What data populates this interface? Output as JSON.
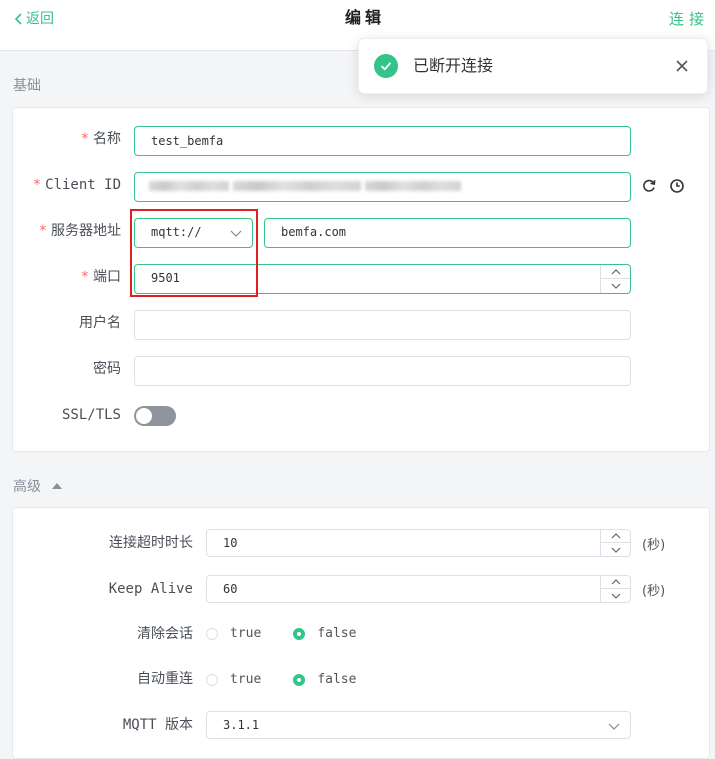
{
  "header": {
    "back_label": "返回",
    "title": "编辑",
    "connect_label": "连接"
  },
  "toast": {
    "message": "已断开连接",
    "status_icon": "check-circle-icon"
  },
  "basic": {
    "section_title": "基础",
    "fields": {
      "name": {
        "label": "名称",
        "required": "*",
        "value": "test_bemfa"
      },
      "client_id": {
        "label": "Client ID",
        "required": "*",
        "value": ""
      },
      "server": {
        "label": "服务器地址",
        "required": "*",
        "protocol": "mqtt://",
        "host": "bemfa.com"
      },
      "port": {
        "label": "端口",
        "required": "*",
        "value": "9501"
      },
      "username": {
        "label": "用户名",
        "value": ""
      },
      "password": {
        "label": "密码",
        "value": ""
      },
      "ssl": {
        "label": "SSL/TLS",
        "enabled": false
      }
    }
  },
  "advanced": {
    "section_title": "高级",
    "connect_timeout": {
      "label": "连接超时时长",
      "value": "10",
      "unit": "(秒)"
    },
    "keep_alive": {
      "label": "Keep Alive",
      "value": "60",
      "unit": "(秒)"
    },
    "clean_session": {
      "label": "清除会话",
      "option_true": "true",
      "option_false": "false",
      "selected": "false"
    },
    "auto_reconnect": {
      "label": "自动重连",
      "option_true": "true",
      "option_false": "false",
      "selected": "false"
    },
    "mqtt_version": {
      "label": "MQTT 版本",
      "value": "3.1.1"
    }
  },
  "colors": {
    "accent": "#34c388",
    "required": "#f56c6c",
    "highlight_box": "#e02020"
  }
}
